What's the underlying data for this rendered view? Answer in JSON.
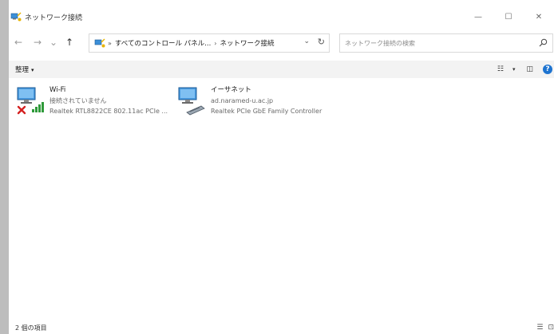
{
  "window": {
    "title": "ネットワーク接続",
    "controls": {
      "minimize": "—",
      "maximize": "☐",
      "close": "✕"
    }
  },
  "nav": {
    "back": "←",
    "forward": "→",
    "recent": "⌄",
    "up": "↑"
  },
  "address": {
    "crumbs": [
      "すべてのコントロール パネル...",
      "ネットワーク接続"
    ],
    "separator": "›",
    "dropdown": "⌄",
    "refresh": "↻"
  },
  "search": {
    "placeholder": "ネットワーク接続の検索"
  },
  "commandbar": {
    "organize": "整理",
    "dropdown_glyph": "▾",
    "view_options": "☷",
    "preview_pane": "◫",
    "help": "?"
  },
  "connections": [
    {
      "name": "Wi-Fi",
      "status": "接続されていません",
      "device": "Realtek RTL8822CE 802.11ac PCIe ...",
      "type": "wifi",
      "disconnected": true
    },
    {
      "name": "イーサネット",
      "status": "ad.naramed-u.ac.jp",
      "device": "Realtek PCIe GbE Family Controller",
      "type": "ethernet",
      "disconnected": false
    }
  ],
  "statusbar": {
    "count": "2 個の項目",
    "details_view": "☰",
    "large_icons_view": "⊡"
  },
  "colors": {
    "accent": "#1e74d0",
    "disconnected": "#d42020",
    "signal": "#2f9a3a",
    "commandbar_bg": "#f3f3f3"
  }
}
